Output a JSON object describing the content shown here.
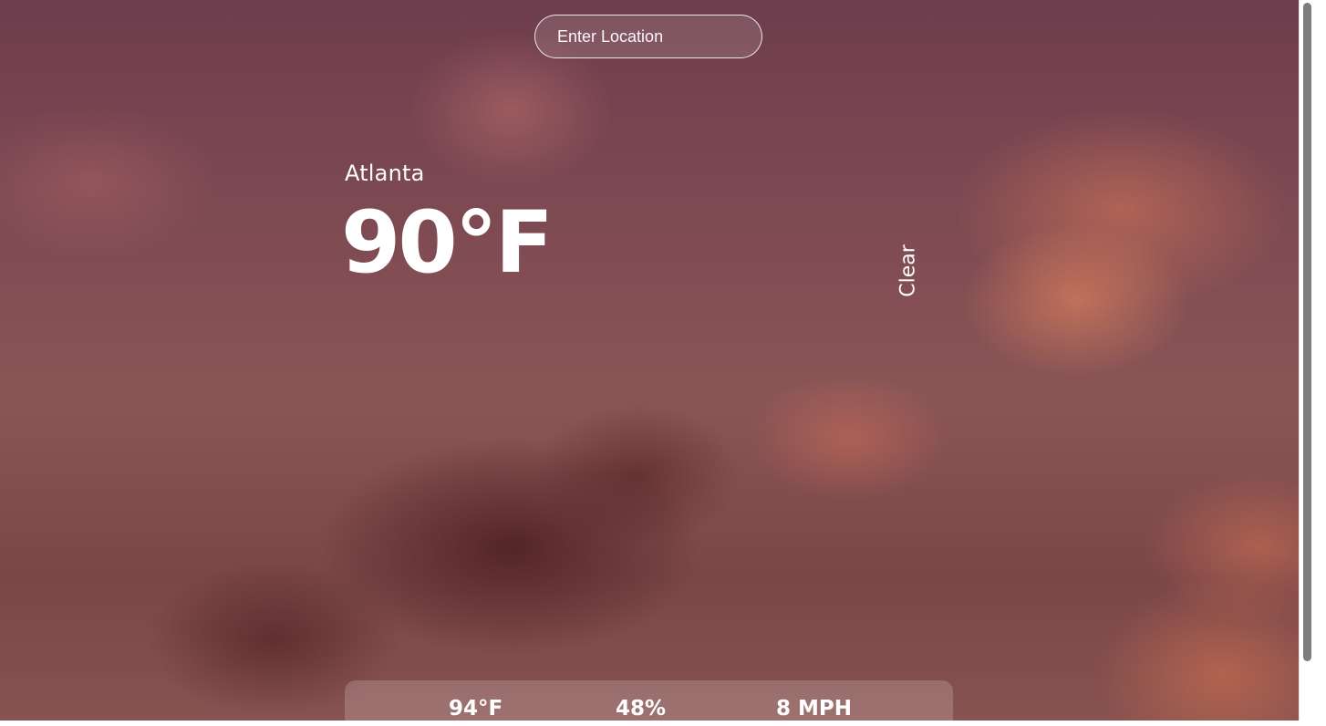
{
  "search": {
    "placeholder": "Enter Location"
  },
  "current": {
    "location": "Atlanta",
    "temperature": "90°F",
    "condition": "Clear"
  },
  "details": {
    "feels_like": "94°F",
    "humidity": "48%",
    "wind": "8 MPH"
  },
  "colors": {
    "text": "#ffffff",
    "sky_base": "#7e4a52",
    "cloud_dark": "#46191c",
    "cloud_glow": "#f08c5f"
  }
}
